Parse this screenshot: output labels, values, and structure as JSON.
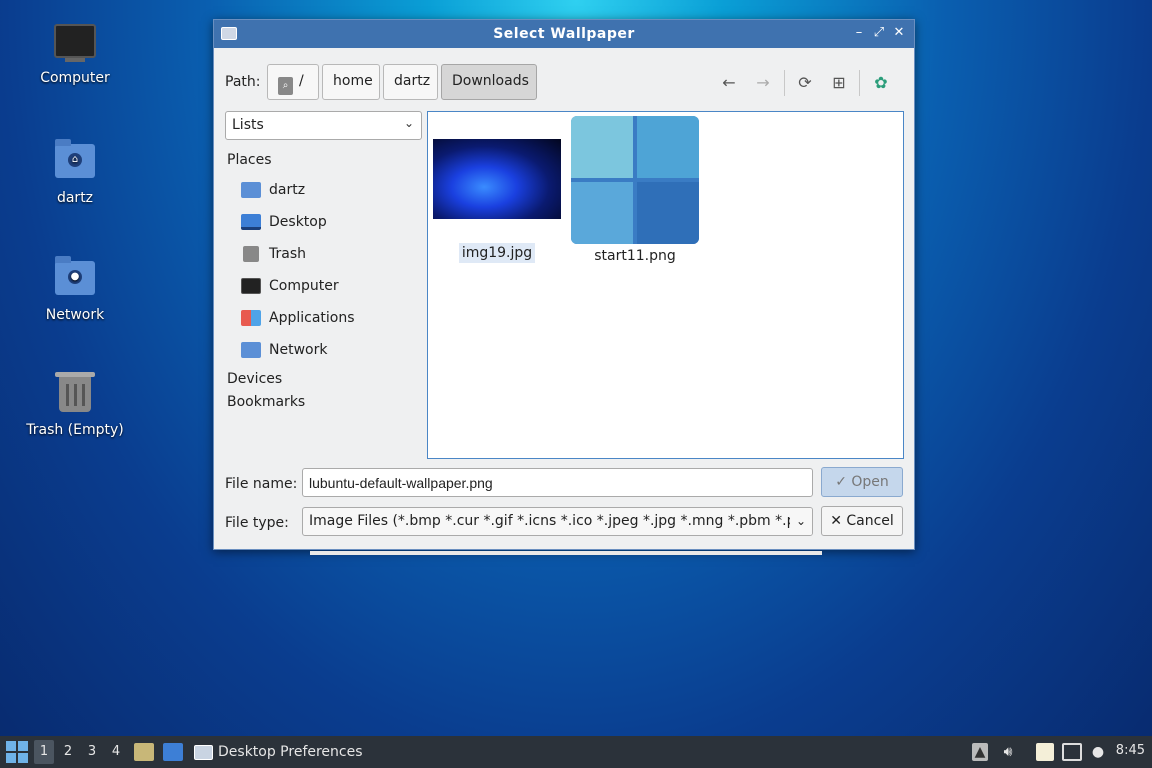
{
  "desktop": {
    "icons": [
      {
        "label": "Computer"
      },
      {
        "label": "dartz"
      },
      {
        "label": "Network"
      },
      {
        "label": "Trash (Empty)"
      }
    ]
  },
  "dialog": {
    "title": "Select Wallpaper",
    "path_label": "Path:",
    "breadcrumbs": [
      "/",
      "home",
      "dartz",
      "Downloads"
    ],
    "active_breadcrumb": "Downloads",
    "sidebar": {
      "view_mode": "Lists",
      "places_heading": "Places",
      "places": [
        {
          "label": "dartz",
          "icon": "home-folder-icon"
        },
        {
          "label": "Desktop",
          "icon": "desktop-icon"
        },
        {
          "label": "Trash",
          "icon": "trash-icon"
        },
        {
          "label": "Computer",
          "icon": "computer-icon"
        },
        {
          "label": "Applications",
          "icon": "applications-icon"
        },
        {
          "label": "Network",
          "icon": "network-folder-icon"
        }
      ],
      "devices_heading": "Devices",
      "bookmarks_heading": "Bookmarks"
    },
    "files": [
      {
        "name": "img19.jpg",
        "selected": true
      },
      {
        "name": "start11.png",
        "selected": false
      }
    ],
    "file_name_label": "File name:",
    "file_name_value": "lubuntu-default-wallpaper.png",
    "file_type_label": "File type:",
    "file_type_value": "Image Files (*.bmp *.cur *.gif *.icns *.ico *.jpeg *.jpg *.mng *.pbm *.pgm",
    "open_label": "Open",
    "cancel_label": "Cancel"
  },
  "taskbar": {
    "workspaces": [
      "1",
      "2",
      "3",
      "4"
    ],
    "active_workspace": "1",
    "task_label": "Desktop Preferences",
    "clock": "8:45"
  },
  "colors": {
    "titlebar": "#3f72af",
    "selection": "#dfe9f6",
    "taskbar": "#2b323a"
  }
}
